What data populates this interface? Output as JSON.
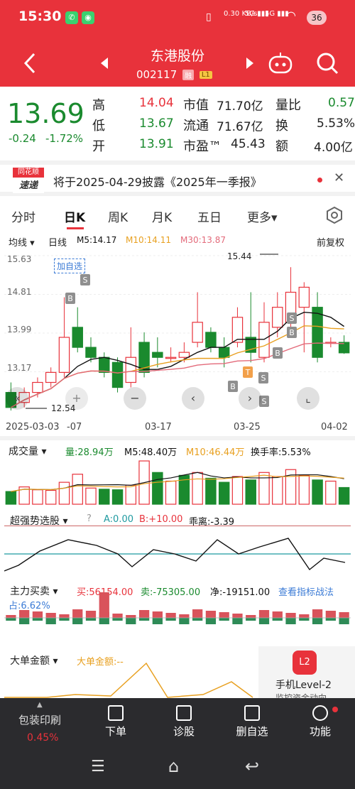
{
  "status": {
    "time": "15:30",
    "speed": "0.30 KB/s",
    "net1": "5G",
    "net2": "5G",
    "battery": "36"
  },
  "header": {
    "title": "东港股份",
    "code": "002117",
    "tag1": "融",
    "tag2": "L1"
  },
  "quote": {
    "price": "13.69",
    "change": "-0.24",
    "change_pct": "-1.72%",
    "high_label": "高",
    "high": "14.04",
    "low_label": "低",
    "low": "13.67",
    "open_label": "开",
    "open": "13.91",
    "mcap_label": "市值",
    "mcap": "71.70亿",
    "float_label": "流通",
    "float": "71.67亿",
    "pe_label": "市盈™",
    "pe": "45.43",
    "vr_label": "量比",
    "vr": "0.57",
    "turn_label": "换",
    "turn": "5.53%",
    "amt_label": "额",
    "amt": "4.00亿"
  },
  "notice": {
    "logo1": "同花顺",
    "logo2": "速递",
    "text": "将于2025-04-29披露《2025年一季报》"
  },
  "tabs": [
    "分时",
    "日K",
    "周K",
    "月K",
    "五日",
    "更多▾"
  ],
  "kline": {
    "ma_label": "均线",
    "period": "日线",
    "ma5": "M5:14.17",
    "ma10": "M10:14.11",
    "ma30": "M30:13.87",
    "adjust": "前复权",
    "y_ticks": [
      "15.63",
      "14.81",
      "13.99",
      "13.17",
      "12.54"
    ],
    "max_label": "15.44",
    "min_label": "12.54",
    "add_watch": "加自选",
    "x_ticks": [
      "2025-03-03",
      "-07",
      "03-17",
      "03-25",
      "04-02"
    ],
    "markers": [
      "B",
      "S",
      "B",
      "S",
      "T",
      "S",
      "B",
      "S",
      "B"
    ]
  },
  "volume": {
    "title": "成交量",
    "vol": "量:28.94万",
    "ma5": "M5:48.40万",
    "ma10": "M10:46.44万",
    "turnover": "换手率:5.53%"
  },
  "strong": {
    "title": "超强势选股",
    "a": "A:0.00",
    "b": "B:+10.00",
    "dev": "乖离:-3.39"
  },
  "main_flow": {
    "title": "主力买卖",
    "buy": "买:56154.00",
    "sell": "卖:-75305.00",
    "net": "净:-19151.00",
    "link": "查看指标战法",
    "share": "占:6.62%"
  },
  "big_order": {
    "title": "大单金额",
    "value": "大单金额:--"
  },
  "level2": {
    "label": "手机Level-2",
    "sub": "监控资金动向"
  },
  "bottom": {
    "left_label": "包装印刷",
    "left_pct": "0.45%",
    "items": [
      "下单",
      "诊股",
      "删自选",
      "功能"
    ]
  },
  "colors": {
    "up": "#e8323b",
    "down": "#1a8a2e",
    "header": "#e8323b",
    "ma5": "#111111",
    "ma10": "#e8a020",
    "ma30": "#e36a7a"
  },
  "chart_data": {
    "type": "candlestick",
    "x_ticks": [
      "2025-03-03",
      "-07",
      "03-17",
      "03-25",
      "04-02"
    ],
    "ylim": [
      12.54,
      15.63
    ],
    "candles": [
      {
        "o": 12.9,
        "c": 12.6,
        "h": 13.1,
        "l": 12.54
      },
      {
        "o": 12.7,
        "c": 12.9,
        "h": 13.0,
        "l": 12.6
      },
      {
        "o": 12.9,
        "c": 13.1,
        "h": 13.2,
        "l": 12.8
      },
      {
        "o": 13.1,
        "c": 13.3,
        "h": 13.4,
        "l": 13.0
      },
      {
        "o": 13.3,
        "c": 14.0,
        "h": 14.8,
        "l": 13.2
      },
      {
        "o": 14.2,
        "c": 13.8,
        "h": 14.6,
        "l": 13.7
      },
      {
        "o": 13.8,
        "c": 13.6,
        "h": 14.0,
        "l": 13.5
      },
      {
        "o": 13.6,
        "c": 13.3,
        "h": 13.7,
        "l": 13.2
      },
      {
        "o": 13.5,
        "c": 13.0,
        "h": 13.6,
        "l": 12.9
      },
      {
        "o": 13.1,
        "c": 13.6,
        "h": 14.2,
        "l": 13.0
      },
      {
        "o": 13.9,
        "c": 13.3,
        "h": 14.1,
        "l": 13.2
      },
      {
        "o": 13.7,
        "c": 13.6,
        "h": 14.0,
        "l": 13.4
      },
      {
        "o": 13.6,
        "c": 13.6,
        "h": 13.8,
        "l": 13.5
      },
      {
        "o": 13.6,
        "c": 13.7,
        "h": 13.9,
        "l": 13.5
      },
      {
        "o": 13.9,
        "c": 14.3,
        "h": 14.9,
        "l": 13.8
      },
      {
        "o": 14.1,
        "c": 13.8,
        "h": 14.2,
        "l": 13.7
      },
      {
        "o": 13.8,
        "c": 13.6,
        "h": 14.0,
        "l": 13.4
      },
      {
        "o": 13.9,
        "c": 14.4,
        "h": 14.6,
        "l": 13.8
      },
      {
        "o": 14.0,
        "c": 13.7,
        "h": 14.9,
        "l": 13.5
      },
      {
        "o": 13.6,
        "c": 14.3,
        "h": 14.7,
        "l": 13.5
      },
      {
        "o": 14.2,
        "c": 14.6,
        "h": 14.9,
        "l": 14.0
      },
      {
        "o": 14.3,
        "c": 14.9,
        "h": 15.4,
        "l": 14.1
      },
      {
        "o": 14.6,
        "c": 15.0,
        "h": 15.1,
        "l": 13.7
      },
      {
        "o": 14.6,
        "c": 13.6,
        "h": 14.9,
        "l": 13.5
      },
      {
        "o": 13.9,
        "c": 13.9,
        "h": 14.0,
        "l": 13.8
      },
      {
        "o": 13.9,
        "c": 13.69,
        "h": 14.04,
        "l": 13.67
      }
    ],
    "volumes": [
      22,
      30,
      25,
      24,
      38,
      52,
      28,
      26,
      25,
      33,
      75,
      55,
      40,
      50,
      55,
      45,
      38,
      48,
      42,
      55,
      48,
      60,
      50,
      42,
      40,
      28.94
    ],
    "vol_dir": [
      "d",
      "u",
      "u",
      "u",
      "u",
      "u",
      "u",
      "d",
      "d",
      "u",
      "u",
      "d",
      "u",
      "d",
      "u",
      "d",
      "d",
      "u",
      "d",
      "u",
      "u",
      "u",
      "u",
      "d",
      "u",
      "d"
    ]
  }
}
